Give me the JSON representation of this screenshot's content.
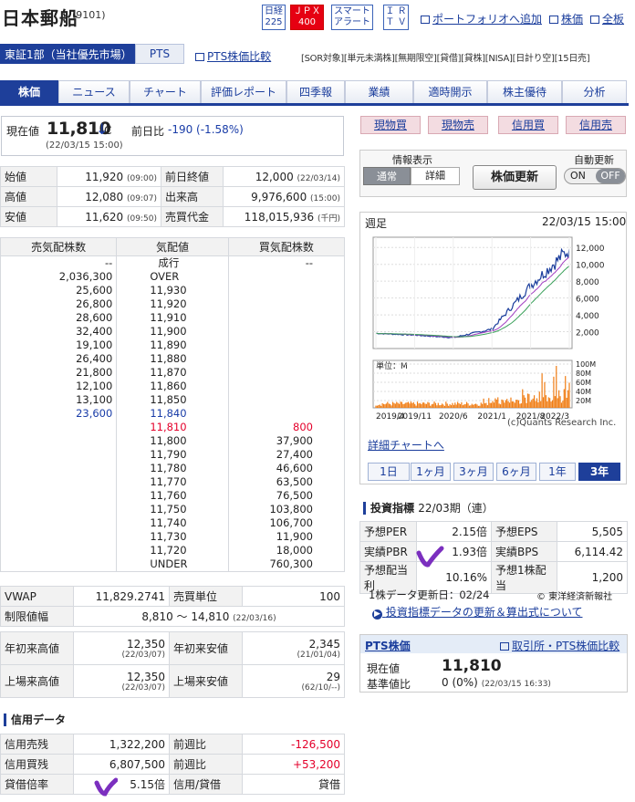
{
  "header": {
    "title": "日本郵船",
    "code": "(9101)",
    "nikkei": [
      "日経",
      "225"
    ],
    "jpx": [
      "ＪＰＸ",
      "400"
    ],
    "smart": [
      "スマート",
      "アラート"
    ],
    "ir": [
      "Ｉ Ｒ",
      "Ｔ Ｖ"
    ],
    "portfolio": "ポートフォリオへ追加",
    "kabuka": "株価",
    "zenban": "全板"
  },
  "market": {
    "name": "東証1部（当社優先市場）",
    "pts": "PTS",
    "pts_compare": "PTS株価比較",
    "tags": "[SOR対象][単元未満株][無期限空][貸借][貸株][NISA][日計り空][15日売]"
  },
  "tabs": [
    "株価",
    "ニュース",
    "チャート",
    "評価レポート",
    "四季報",
    "業績",
    "適時開示",
    "株主優待",
    "分析"
  ],
  "price": {
    "label": "現在値",
    "value": "11,810",
    "arrow": "↓",
    "type": "C",
    "change_label": "前日比",
    "change": "-190 (-1.58%)",
    "time": "(22/03/15 15:00)"
  },
  "stats": [
    [
      "始値",
      "11,920",
      "(09:00)",
      "前日終値",
      "12,000",
      "(22/03/14)"
    ],
    [
      "高値",
      "12,080",
      "(09:07)",
      "出来高",
      "9,976,600",
      "(15:00)"
    ],
    [
      "安値",
      "11,620",
      "(09:50)",
      "売買代金",
      "118,015,936",
      "(千円)"
    ]
  ],
  "book": {
    "headers": [
      "売気配株数",
      "気配値",
      "買気配株数"
    ],
    "rows": [
      [
        "--",
        "成行",
        "--"
      ],
      [
        "2,036,300",
        "OVER",
        ""
      ],
      [
        "25,600",
        "11,930",
        ""
      ],
      [
        "26,800",
        "11,920",
        ""
      ],
      [
        "28,600",
        "11,910",
        ""
      ],
      [
        "32,400",
        "11,900",
        ""
      ],
      [
        "19,100",
        "11,890",
        ""
      ],
      [
        "26,400",
        "11,880",
        ""
      ],
      [
        "21,800",
        "11,870",
        ""
      ],
      [
        "12,100",
        "11,860",
        ""
      ],
      [
        "13,100",
        "11,850",
        ""
      ],
      [
        "23,600",
        "11,840",
        ""
      ],
      [
        "",
        "11,810",
        "800"
      ],
      [
        "",
        "11,800",
        "37,900"
      ],
      [
        "",
        "11,790",
        "27,400"
      ],
      [
        "",
        "11,780",
        "46,600"
      ],
      [
        "",
        "11,770",
        "63,500"
      ],
      [
        "",
        "11,760",
        "76,500"
      ],
      [
        "",
        "11,750",
        "103,800"
      ],
      [
        "",
        "11,740",
        "106,700"
      ],
      [
        "",
        "11,730",
        "11,900"
      ],
      [
        "",
        "11,720",
        "18,000"
      ],
      [
        "",
        "UNDER",
        "760,300"
      ]
    ]
  },
  "vwap": {
    "l1": "VWAP",
    "v1": "11,829.2741",
    "l2": "売買単位",
    "v2": "100",
    "l3": "制限値幅",
    "v3": "8,810 〜 14,810",
    "v3s": "(22/03/16)"
  },
  "ytd": [
    [
      "年初来高値",
      "12,350",
      "(22/03/07)",
      "年初来安値",
      "2,345",
      "(21/01/04)"
    ],
    [
      "上場来高値",
      "12,350",
      "(22/03/07)",
      "上場来安値",
      "29",
      "(62/10/--)"
    ]
  ],
  "credit": {
    "title": "信用データ",
    "rows": [
      [
        "信用売残",
        "1,322,200",
        "前週比",
        "-126,500"
      ],
      [
        "信用買残",
        "6,807,500",
        "前週比",
        "+53,200"
      ],
      [
        "貸借倍率",
        "5.15倍",
        "信用/貸借",
        "貸借"
      ]
    ]
  },
  "trade": [
    "現物買",
    "現物売",
    "信用買",
    "信用売"
  ],
  "info": {
    "label": "情報表示",
    "normal": "通常",
    "detail": "詳細",
    "update": "株価更新",
    "auto": "自動更新",
    "on": "ON",
    "off": "OFF"
  },
  "chart": {
    "period": "週足",
    "time": "22/03/15 15:00",
    "yticks": [
      "12,000",
      "10,000",
      "8,000",
      "6,000",
      "4,000",
      "2,000"
    ],
    "vol_label": "単位：M",
    "vticks": [
      "100M",
      "80M",
      "60M",
      "40M",
      "20M"
    ],
    "xticks": [
      "2019/4",
      "2019/11",
      "2020/6",
      "2021/1",
      "2021/8",
      "2022/3"
    ],
    "credit": "(c)Quants Research Inc.",
    "detail": "詳細チャートへ",
    "periods": [
      "1日",
      "1ヶ月",
      "3ヶ月",
      "6ヶ月",
      "1年",
      "3年"
    ]
  },
  "chart_data": {
    "type": "line",
    "x": [
      "2019/4",
      "2019/11",
      "2020/6",
      "2021/1",
      "2021/8",
      "2022/3"
    ],
    "series": [
      {
        "values": [
          1800,
          1600,
          1300,
          2300,
          7500,
          11810
        ]
      }
    ],
    "ylim": [
      0,
      13000
    ]
  },
  "invest": {
    "title": "投資指標",
    "period": "22/03期（連）",
    "rows": [
      [
        "予想PER",
        "2.15倍",
        "予想EPS",
        "5,505"
      ],
      [
        "実績PBR",
        "1.93倍",
        "実績BPS",
        "6,114.42"
      ],
      [
        "予想配当利",
        "10.16%",
        "予想1株配当",
        "1,200"
      ]
    ],
    "update": "1株データ更新日：02/24",
    "source": "© 東洋経済新報社",
    "note": "投資指標データの更新＆算出式について"
  },
  "ptsbox": {
    "title": "PTS株価",
    "link": "取引所・PTS株価比較",
    "l1": "現在値",
    "v1": "11,810",
    "l2": "基準値比",
    "v2": "0 (0%)",
    "t2": "(22/03/15 16:33)"
  },
  "colors": {
    "brand": "#1e3f9a",
    "down": "#1a3da8",
    "up": "#e4002b",
    "check": "#7b2fbf"
  }
}
